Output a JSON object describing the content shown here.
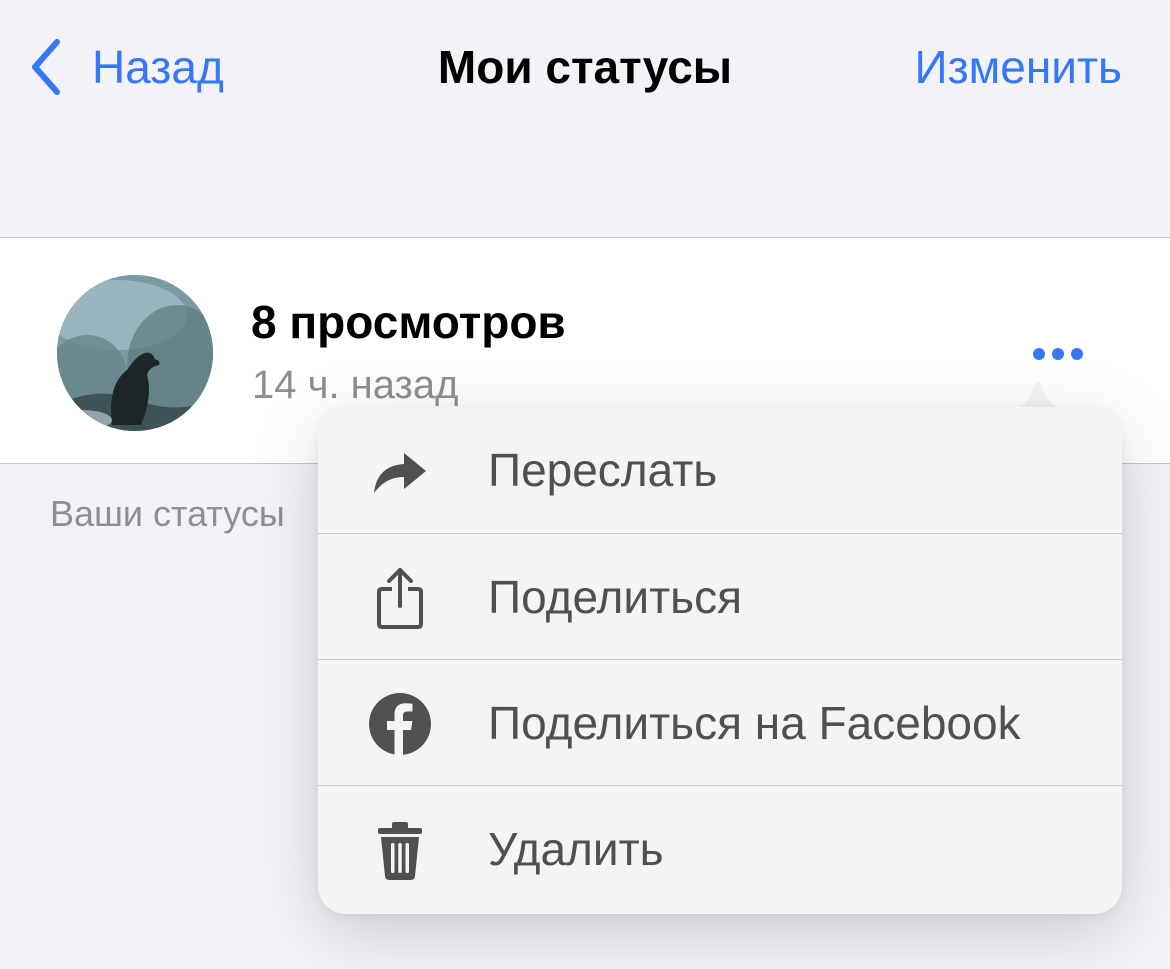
{
  "navbar": {
    "back_label": "Назад",
    "title": "Мои статусы",
    "edit_label": "Изменить",
    "accent_color": "#3478f6"
  },
  "status": {
    "views": "8 просмотров",
    "time": "14 ч. назад"
  },
  "footer": {
    "caption": "Ваши статусы"
  },
  "menu": {
    "items": [
      {
        "label": "Переслать",
        "icon": "forward-arrow-icon"
      },
      {
        "label": "Поделиться",
        "icon": "share-icon"
      },
      {
        "label": "Поделиться на Facebook",
        "icon": "facebook-icon"
      },
      {
        "label": "Удалить",
        "icon": "trash-icon"
      }
    ]
  }
}
